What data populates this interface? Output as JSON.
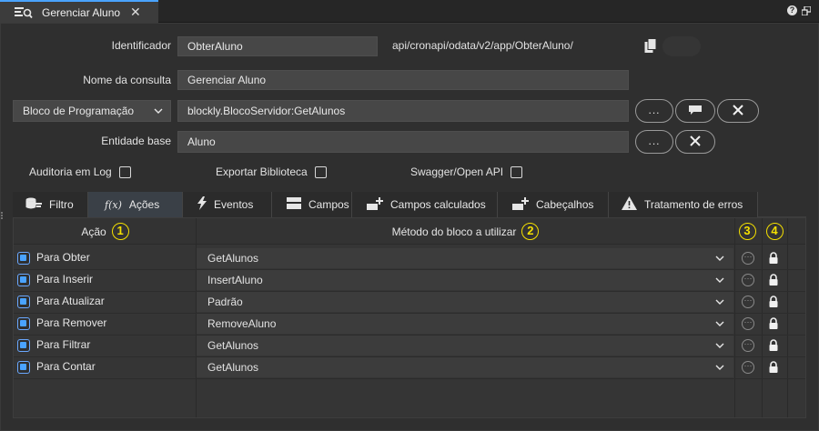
{
  "window": {
    "tab_title": "Gerenciar Aluno",
    "close_glyph": "✕",
    "help_glyph": "?"
  },
  "form": {
    "identificador_label": "Identificador",
    "identificador_value": "ObterAluno",
    "endpoint_url": "api/cronapi/odata/v2/app/ObterAluno/",
    "nome_label": "Nome da consulta",
    "nome_value": "Gerenciar Aluno",
    "tipo_select": "Bloco de Programação",
    "bloco_value": "blockly.BlocoServidor:GetAlunos",
    "entidade_label": "Entidade base",
    "entidade_value": "Aluno",
    "more_label": "...",
    "auditoria_label": "Auditoria em Log",
    "exportar_label": "Exportar Biblioteca",
    "swagger_label": "Swagger/Open API"
  },
  "tabs": [
    {
      "label": "Filtro",
      "icon": "database-filter-icon"
    },
    {
      "label": "Ações",
      "icon": "function-icon",
      "active": true
    },
    {
      "label": "Eventos",
      "icon": "lightning-icon"
    },
    {
      "label": "Campos",
      "icon": "columns-icon"
    },
    {
      "label": "Campos calculados",
      "icon": "add-field-icon"
    },
    {
      "label": "Cabeçalhos",
      "icon": "add-header-icon"
    },
    {
      "label": "Tratamento de erros",
      "icon": "warning-icon"
    }
  ],
  "grid": {
    "col_action": "Ação",
    "col_method": "Método do bloco a utilizar",
    "badges": [
      "1",
      "2",
      "3",
      "4"
    ],
    "rows": [
      {
        "action": "Para Obter",
        "method": "GetAlunos"
      },
      {
        "action": "Para Inserir",
        "method": "InsertAluno"
      },
      {
        "action": "Para Atualizar",
        "method": "Padrão"
      },
      {
        "action": "Para Remover",
        "method": "RemoveAluno"
      },
      {
        "action": "Para Filtrar",
        "method": "GetAlunos"
      },
      {
        "action": "Para Contar",
        "method": "GetAlunos"
      }
    ]
  },
  "colors": {
    "accent": "#4aa3ff",
    "badge": "#f5e000",
    "background": "#2f2f2f"
  }
}
